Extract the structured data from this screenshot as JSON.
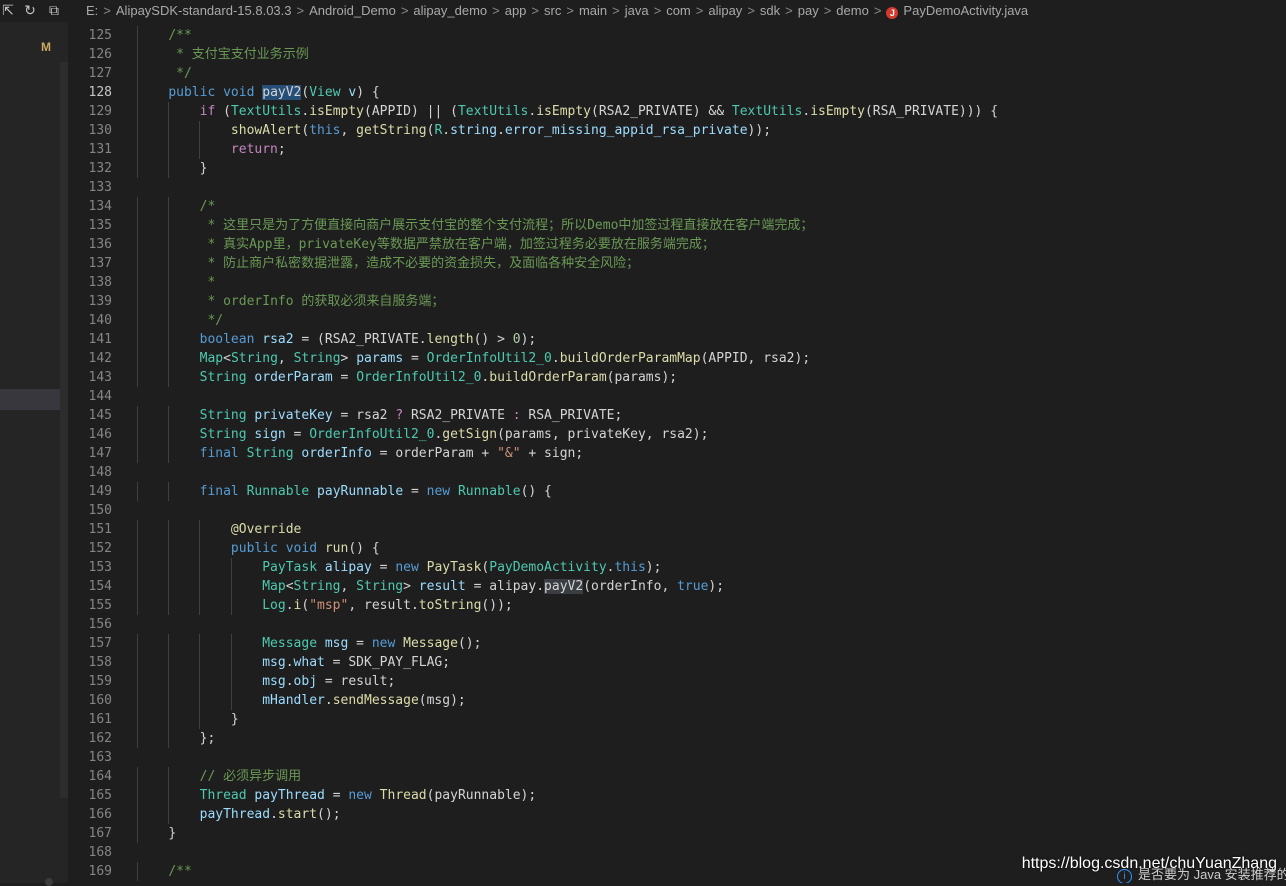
{
  "toolbar": {
    "icons": [
      "collapse-icon",
      "refresh-icon",
      "collapse-all-icon"
    ]
  },
  "breadcrumb": {
    "items": [
      "E:",
      "AlipaySDK-standard-15.8.03.3",
      "Android_Demo",
      "alipay_demo",
      "app",
      "src",
      "main",
      "java",
      "com",
      "alipay",
      "sdk",
      "pay",
      "demo"
    ],
    "separator": ">",
    "file_badge": "J",
    "file": "PayDemoActivity.java"
  },
  "sidebar": {
    "git_status": "M"
  },
  "editor": {
    "active_line": 128,
    "lines": [
      {
        "n": "125",
        "indent": 1,
        "t": [
          [
            "cm",
            "/**"
          ]
        ]
      },
      {
        "n": "126",
        "indent": 1,
        "t": [
          [
            "cm",
            " * 支付宝支付业务示例"
          ]
        ]
      },
      {
        "n": "127",
        "indent": 1,
        "t": [
          [
            "cm",
            " */"
          ]
        ]
      },
      {
        "n": "128",
        "indent": 1,
        "t": [
          [
            "kw",
            "public"
          ],
          [
            "pl",
            " "
          ],
          [
            "kw",
            "void"
          ],
          [
            "pl",
            " "
          ],
          [
            "hl",
            "payV2"
          ],
          [
            "pl",
            "("
          ],
          [
            "ty",
            "View"
          ],
          [
            "pl",
            " "
          ],
          [
            "vr",
            "v"
          ],
          [
            "pl",
            ") {"
          ]
        ]
      },
      {
        "n": "129",
        "indent": 2,
        "t": [
          [
            "ctl",
            "if"
          ],
          [
            "pl",
            " ("
          ],
          [
            "ty",
            "TextUtils"
          ],
          [
            "pl",
            "."
          ],
          [
            "fn",
            "isEmpty"
          ],
          [
            "pl",
            "(APPID) || ("
          ],
          [
            "ty",
            "TextUtils"
          ],
          [
            "pl",
            "."
          ],
          [
            "fn",
            "isEmpty"
          ],
          [
            "pl",
            "(RSA2_PRIVATE) && "
          ],
          [
            "ty",
            "TextUtils"
          ],
          [
            "pl",
            "."
          ],
          [
            "fn",
            "isEmpty"
          ],
          [
            "pl",
            "(RSA_PRIVATE))) {"
          ]
        ]
      },
      {
        "n": "130",
        "indent": 3,
        "t": [
          [
            "fn",
            "showAlert"
          ],
          [
            "pl",
            "("
          ],
          [
            "kw",
            "this"
          ],
          [
            "pl",
            ", "
          ],
          [
            "fn",
            "getString"
          ],
          [
            "pl",
            "("
          ],
          [
            "ty",
            "R"
          ],
          [
            "pl",
            "."
          ],
          [
            "vr",
            "string"
          ],
          [
            "pl",
            "."
          ],
          [
            "vr",
            "error_missing_appid_rsa_private"
          ],
          [
            "pl",
            "));"
          ]
        ]
      },
      {
        "n": "131",
        "indent": 3,
        "t": [
          [
            "ctl",
            "return"
          ],
          [
            "pl",
            ";"
          ]
        ]
      },
      {
        "n": "132",
        "indent": 2,
        "t": [
          [
            "pl",
            "}"
          ]
        ]
      },
      {
        "n": "133",
        "indent": 0,
        "t": []
      },
      {
        "n": "134",
        "indent": 2,
        "t": [
          [
            "cm",
            "/*"
          ]
        ]
      },
      {
        "n": "135",
        "indent": 2,
        "t": [
          [
            "cm",
            " * 这里只是为了方便直接向商户展示支付宝的整个支付流程；所以Demo中加签过程直接放在客户端完成；"
          ]
        ]
      },
      {
        "n": "136",
        "indent": 2,
        "t": [
          [
            "cm",
            " * 真实App里，privateKey等数据严禁放在客户端，加签过程务必要放在服务端完成；"
          ]
        ]
      },
      {
        "n": "137",
        "indent": 2,
        "t": [
          [
            "cm",
            " * 防止商户私密数据泄露，造成不必要的资金损失，及面临各种安全风险；"
          ]
        ]
      },
      {
        "n": "138",
        "indent": 2,
        "t": [
          [
            "cm",
            " *"
          ]
        ]
      },
      {
        "n": "139",
        "indent": 2,
        "t": [
          [
            "cm",
            " * orderInfo 的获取必须来自服务端；"
          ]
        ]
      },
      {
        "n": "140",
        "indent": 2,
        "t": [
          [
            "cm",
            " */"
          ]
        ]
      },
      {
        "n": "141",
        "indent": 2,
        "t": [
          [
            "kw",
            "boolean"
          ],
          [
            "pl",
            " "
          ],
          [
            "vr",
            "rsa2"
          ],
          [
            "pl",
            " = (RSA2_PRIVATE."
          ],
          [
            "fn",
            "length"
          ],
          [
            "pl",
            "() > "
          ],
          [
            "nm",
            "0"
          ],
          [
            "pl",
            ");"
          ]
        ]
      },
      {
        "n": "142",
        "indent": 2,
        "t": [
          [
            "ty",
            "Map"
          ],
          [
            "pl",
            "<"
          ],
          [
            "ty",
            "String"
          ],
          [
            "pl",
            ", "
          ],
          [
            "ty",
            "String"
          ],
          [
            "pl",
            "> "
          ],
          [
            "vr",
            "params"
          ],
          [
            "pl",
            " = "
          ],
          [
            "ty",
            "OrderInfoUtil2_0"
          ],
          [
            "pl",
            "."
          ],
          [
            "fn",
            "buildOrderParamMap"
          ],
          [
            "pl",
            "(APPID, rsa2);"
          ]
        ]
      },
      {
        "n": "143",
        "indent": 2,
        "t": [
          [
            "ty",
            "String"
          ],
          [
            "pl",
            " "
          ],
          [
            "vr",
            "orderParam"
          ],
          [
            "pl",
            " = "
          ],
          [
            "ty",
            "OrderInfoUtil2_0"
          ],
          [
            "pl",
            "."
          ],
          [
            "fn",
            "buildOrderParam"
          ],
          [
            "pl",
            "(params);"
          ]
        ]
      },
      {
        "n": "144",
        "indent": 0,
        "t": []
      },
      {
        "n": "145",
        "indent": 2,
        "t": [
          [
            "ty",
            "String"
          ],
          [
            "pl",
            " "
          ],
          [
            "vr",
            "privateKey"
          ],
          [
            "pl",
            " = rsa2 "
          ],
          [
            "ctl",
            "?"
          ],
          [
            "pl",
            " RSA2_PRIVATE "
          ],
          [
            "ctl",
            ":"
          ],
          [
            "pl",
            " RSA_PRIVATE;"
          ]
        ]
      },
      {
        "n": "146",
        "indent": 2,
        "t": [
          [
            "ty",
            "String"
          ],
          [
            "pl",
            " "
          ],
          [
            "vr",
            "sign"
          ],
          [
            "pl",
            " = "
          ],
          [
            "ty",
            "OrderInfoUtil2_0"
          ],
          [
            "pl",
            "."
          ],
          [
            "fn",
            "getSign"
          ],
          [
            "pl",
            "(params, privateKey, rsa2);"
          ]
        ]
      },
      {
        "n": "147",
        "indent": 2,
        "t": [
          [
            "kw",
            "final"
          ],
          [
            "pl",
            " "
          ],
          [
            "ty",
            "String"
          ],
          [
            "pl",
            " "
          ],
          [
            "vr",
            "orderInfo"
          ],
          [
            "pl",
            " = orderParam + "
          ],
          [
            "st",
            "\"&\""
          ],
          [
            "pl",
            " + sign;"
          ]
        ]
      },
      {
        "n": "148",
        "indent": 0,
        "t": []
      },
      {
        "n": "149",
        "indent": 2,
        "t": [
          [
            "kw",
            "final"
          ],
          [
            "pl",
            " "
          ],
          [
            "ty",
            "Runnable"
          ],
          [
            "pl",
            " "
          ],
          [
            "vr",
            "payRunnable"
          ],
          [
            "pl",
            " = "
          ],
          [
            "kw",
            "new"
          ],
          [
            "pl",
            " "
          ],
          [
            "ty",
            "Runnable"
          ],
          [
            "pl",
            "() {"
          ]
        ]
      },
      {
        "n": "150",
        "indent": 0,
        "t": []
      },
      {
        "n": "151",
        "indent": 3,
        "t": [
          [
            "fn",
            "@Override"
          ]
        ]
      },
      {
        "n": "152",
        "indent": 3,
        "t": [
          [
            "kw",
            "public"
          ],
          [
            "pl",
            " "
          ],
          [
            "kw",
            "void"
          ],
          [
            "pl",
            " "
          ],
          [
            "fn",
            "run"
          ],
          [
            "pl",
            "() {"
          ]
        ]
      },
      {
        "n": "153",
        "indent": 4,
        "t": [
          [
            "ty",
            "PayTask"
          ],
          [
            "pl",
            " "
          ],
          [
            "vr",
            "alipay"
          ],
          [
            "pl",
            " = "
          ],
          [
            "kw",
            "new"
          ],
          [
            "pl",
            " "
          ],
          [
            "fn",
            "PayTask"
          ],
          [
            "pl",
            "("
          ],
          [
            "ty",
            "PayDemoActivity"
          ],
          [
            "pl",
            "."
          ],
          [
            "kw",
            "this"
          ],
          [
            "pl",
            ");"
          ]
        ]
      },
      {
        "n": "154",
        "indent": 4,
        "t": [
          [
            "ty",
            "Map"
          ],
          [
            "pl",
            "<"
          ],
          [
            "ty",
            "String"
          ],
          [
            "pl",
            ", "
          ],
          [
            "ty",
            "String"
          ],
          [
            "pl",
            "> "
          ],
          [
            "vr",
            "result"
          ],
          [
            "pl",
            " = alipay."
          ],
          [
            "hl2",
            "payV2"
          ],
          [
            "pl",
            "(orderInfo, "
          ],
          [
            "kw",
            "true"
          ],
          [
            "pl",
            ");"
          ]
        ]
      },
      {
        "n": "155",
        "indent": 4,
        "t": [
          [
            "ty",
            "Log"
          ],
          [
            "pl",
            "."
          ],
          [
            "fn",
            "i"
          ],
          [
            "pl",
            "("
          ],
          [
            "st",
            "\"msp\""
          ],
          [
            "pl",
            ", result."
          ],
          [
            "fn",
            "toString"
          ],
          [
            "pl",
            "());"
          ]
        ]
      },
      {
        "n": "156",
        "indent": 0,
        "t": []
      },
      {
        "n": "157",
        "indent": 4,
        "t": [
          [
            "ty",
            "Message"
          ],
          [
            "pl",
            " "
          ],
          [
            "vr",
            "msg"
          ],
          [
            "pl",
            " = "
          ],
          [
            "kw",
            "new"
          ],
          [
            "pl",
            " "
          ],
          [
            "fn",
            "Message"
          ],
          [
            "pl",
            "();"
          ]
        ]
      },
      {
        "n": "158",
        "indent": 4,
        "t": [
          [
            "vr",
            "msg"
          ],
          [
            "pl",
            "."
          ],
          [
            "vr",
            "what"
          ],
          [
            "pl",
            " = SDK_PAY_FLAG;"
          ]
        ]
      },
      {
        "n": "159",
        "indent": 4,
        "t": [
          [
            "vr",
            "msg"
          ],
          [
            "pl",
            "."
          ],
          [
            "vr",
            "obj"
          ],
          [
            "pl",
            " = result;"
          ]
        ]
      },
      {
        "n": "160",
        "indent": 4,
        "t": [
          [
            "vr",
            "mHandler"
          ],
          [
            "pl",
            "."
          ],
          [
            "fn",
            "sendMessage"
          ],
          [
            "pl",
            "(msg);"
          ]
        ]
      },
      {
        "n": "161",
        "indent": 3,
        "t": [
          [
            "pl",
            "}"
          ]
        ]
      },
      {
        "n": "162",
        "indent": 2,
        "t": [
          [
            "pl",
            "};"
          ]
        ]
      },
      {
        "n": "163",
        "indent": 0,
        "t": []
      },
      {
        "n": "164",
        "indent": 2,
        "t": [
          [
            "cm",
            "// 必须异步调用"
          ]
        ]
      },
      {
        "n": "165",
        "indent": 2,
        "t": [
          [
            "ty",
            "Thread"
          ],
          [
            "pl",
            " "
          ],
          [
            "vr",
            "payThread"
          ],
          [
            "pl",
            " = "
          ],
          [
            "kw",
            "new"
          ],
          [
            "pl",
            " "
          ],
          [
            "fn",
            "Thread"
          ],
          [
            "pl",
            "(payRunnable);"
          ]
        ]
      },
      {
        "n": "166",
        "indent": 2,
        "t": [
          [
            "vr",
            "payThread"
          ],
          [
            "pl",
            "."
          ],
          [
            "fn",
            "start"
          ],
          [
            "pl",
            "();"
          ]
        ]
      },
      {
        "n": "167",
        "indent": 1,
        "t": [
          [
            "pl",
            "}"
          ]
        ]
      },
      {
        "n": "168",
        "indent": 0,
        "t": []
      },
      {
        "n": "169",
        "indent": 1,
        "t": [
          [
            "cm",
            "/**"
          ]
        ]
      }
    ]
  },
  "watermark": "https://blog.csdn.net/chuYuanZhang",
  "notification": {
    "icon": "info-icon",
    "text": "是否要为 Java 安装推荐的"
  },
  "colors": {
    "background": "#1e1e1e",
    "sidebar": "#252526",
    "keyword": "#569cd6",
    "control": "#c586c0",
    "type": "#4ec9b0",
    "function": "#dcdcaa",
    "variable": "#9cdcfe",
    "string": "#ce9178",
    "comment": "#6a9955",
    "number": "#b5cea8"
  }
}
